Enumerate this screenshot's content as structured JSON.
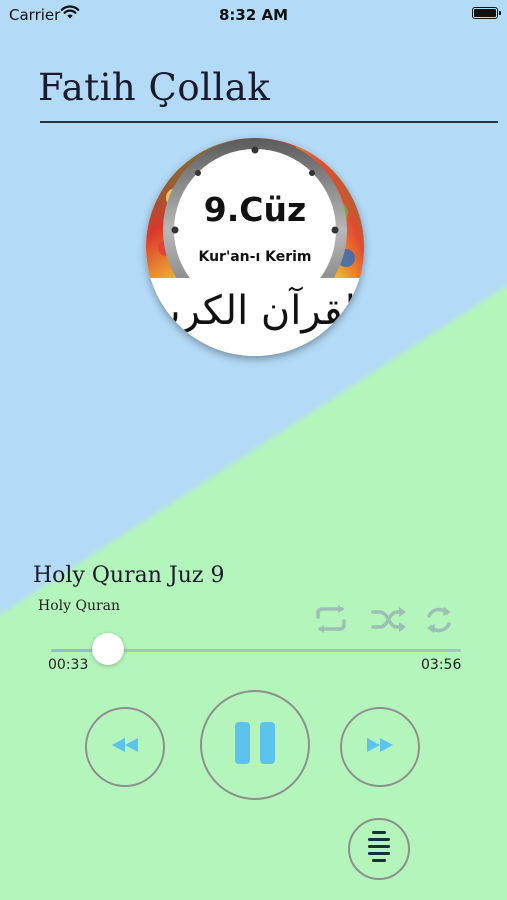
{
  "status_bar": {
    "carrier": "Carrier",
    "time": "8:32 AM",
    "wifi_icon": "wifi-icon",
    "battery_icon": "battery-icon"
  },
  "header": {
    "artist": "Fatih Çollak"
  },
  "album_art": {
    "title": "9.Cüz",
    "subtitle": "Kur'an-ı Kerim",
    "arabic": "القرآن الكريم"
  },
  "track": {
    "title": "Holy Quran Juz 9",
    "album": "Holy Quran"
  },
  "modes": {
    "repeat_icon": "repeat-icon",
    "shuffle_icon": "shuffle-icon",
    "loop_icon": "loop-icon"
  },
  "progress": {
    "elapsed": "00:33",
    "total": "03:56",
    "fraction": 0.14
  },
  "controls": {
    "rewind_icon": "rewind-icon",
    "pause_icon": "pause-icon",
    "forward_icon": "fast-forward-icon",
    "playlist_icon": "playlist-icon"
  },
  "colors": {
    "accent": "#5bc3ee",
    "icon_muted": "#9dc0b6",
    "background_blue": "#b3daf7",
    "background_green": "#b4f5bb"
  }
}
